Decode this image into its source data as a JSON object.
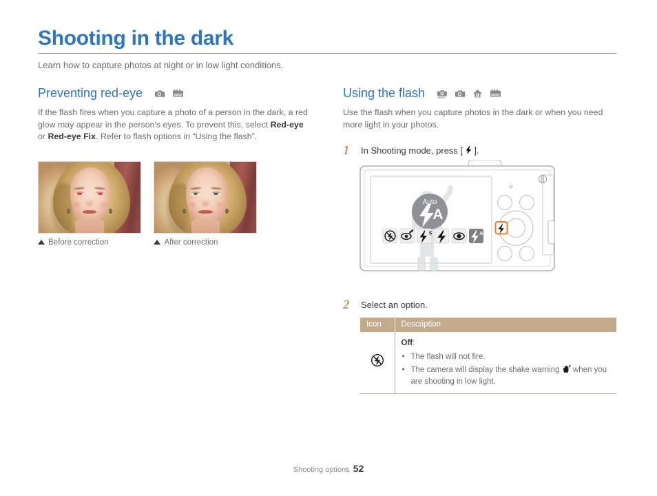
{
  "header": {
    "title": "Shooting in the dark",
    "subtitle": "Learn how to capture photos at night or in low light conditions."
  },
  "left_column": {
    "section_title": "Preventing red-eye",
    "mode_icons": [
      "camera-program-icon",
      "scene-mode-icon"
    ],
    "body_parts": {
      "p1": "If the flash fires when you capture a photo of a person in the dark, a red glow may appear in the person's eyes. To prevent this, select ",
      "bold1": "Red-eye",
      "p2": " or ",
      "bold2": "Red-eye Fix",
      "p3": ". Refer to flash options in “Using the flash”."
    },
    "photos": [
      {
        "caption": "Before correction",
        "state": "red-eye"
      },
      {
        "caption": "After correction",
        "state": "fixed-eye"
      }
    ]
  },
  "right_column": {
    "section_title": "Using the flash",
    "mode_icons": [
      "smart-auto-icon",
      "camera-program-icon",
      "scene-person-icon",
      "scene-mode-icon"
    ],
    "intro": "Use the flash when you capture photos in the dark or when you need more light in your photos.",
    "step1": {
      "number": "1",
      "text_before": "In Shooting mode, press [",
      "glyph": "flash-icon",
      "text_after": "]."
    },
    "camera": {
      "screen_label": "Auto",
      "flash_options": [
        "flash-off-icon",
        "red-eye-fix-icon",
        "slow-sync-icon",
        "fill-in-icon",
        "red-eye-icon",
        "auto-flash-icon"
      ],
      "selected_index": 5,
      "highlighted_button": "flash-button"
    },
    "step2": {
      "number": "2",
      "text": "Select an option."
    },
    "table": {
      "headers": [
        "Icon",
        "Description"
      ],
      "rows": [
        {
          "icon": "flash-off-icon",
          "name": "Off",
          "name_suffix": ":",
          "bullets": [
            "The flash will not fire.",
            "The camera will display the shake warning \u0000 when you are shooting in low light."
          ],
          "bullet2_before": "The camera will display the shake warning ",
          "bullet2_glyph": "shake-warning-icon",
          "bullet2_after": " when you are shooting in low light."
        }
      ]
    }
  },
  "footer": {
    "label": "Shooting options",
    "page_number": "52"
  },
  "colors": {
    "heading_blue": "#2f76bc",
    "table_header_tan": "#c2ab8d",
    "step_number": "#b89b77",
    "body_gray": "#6d6e71",
    "highlight_orange": "#f0812a"
  }
}
